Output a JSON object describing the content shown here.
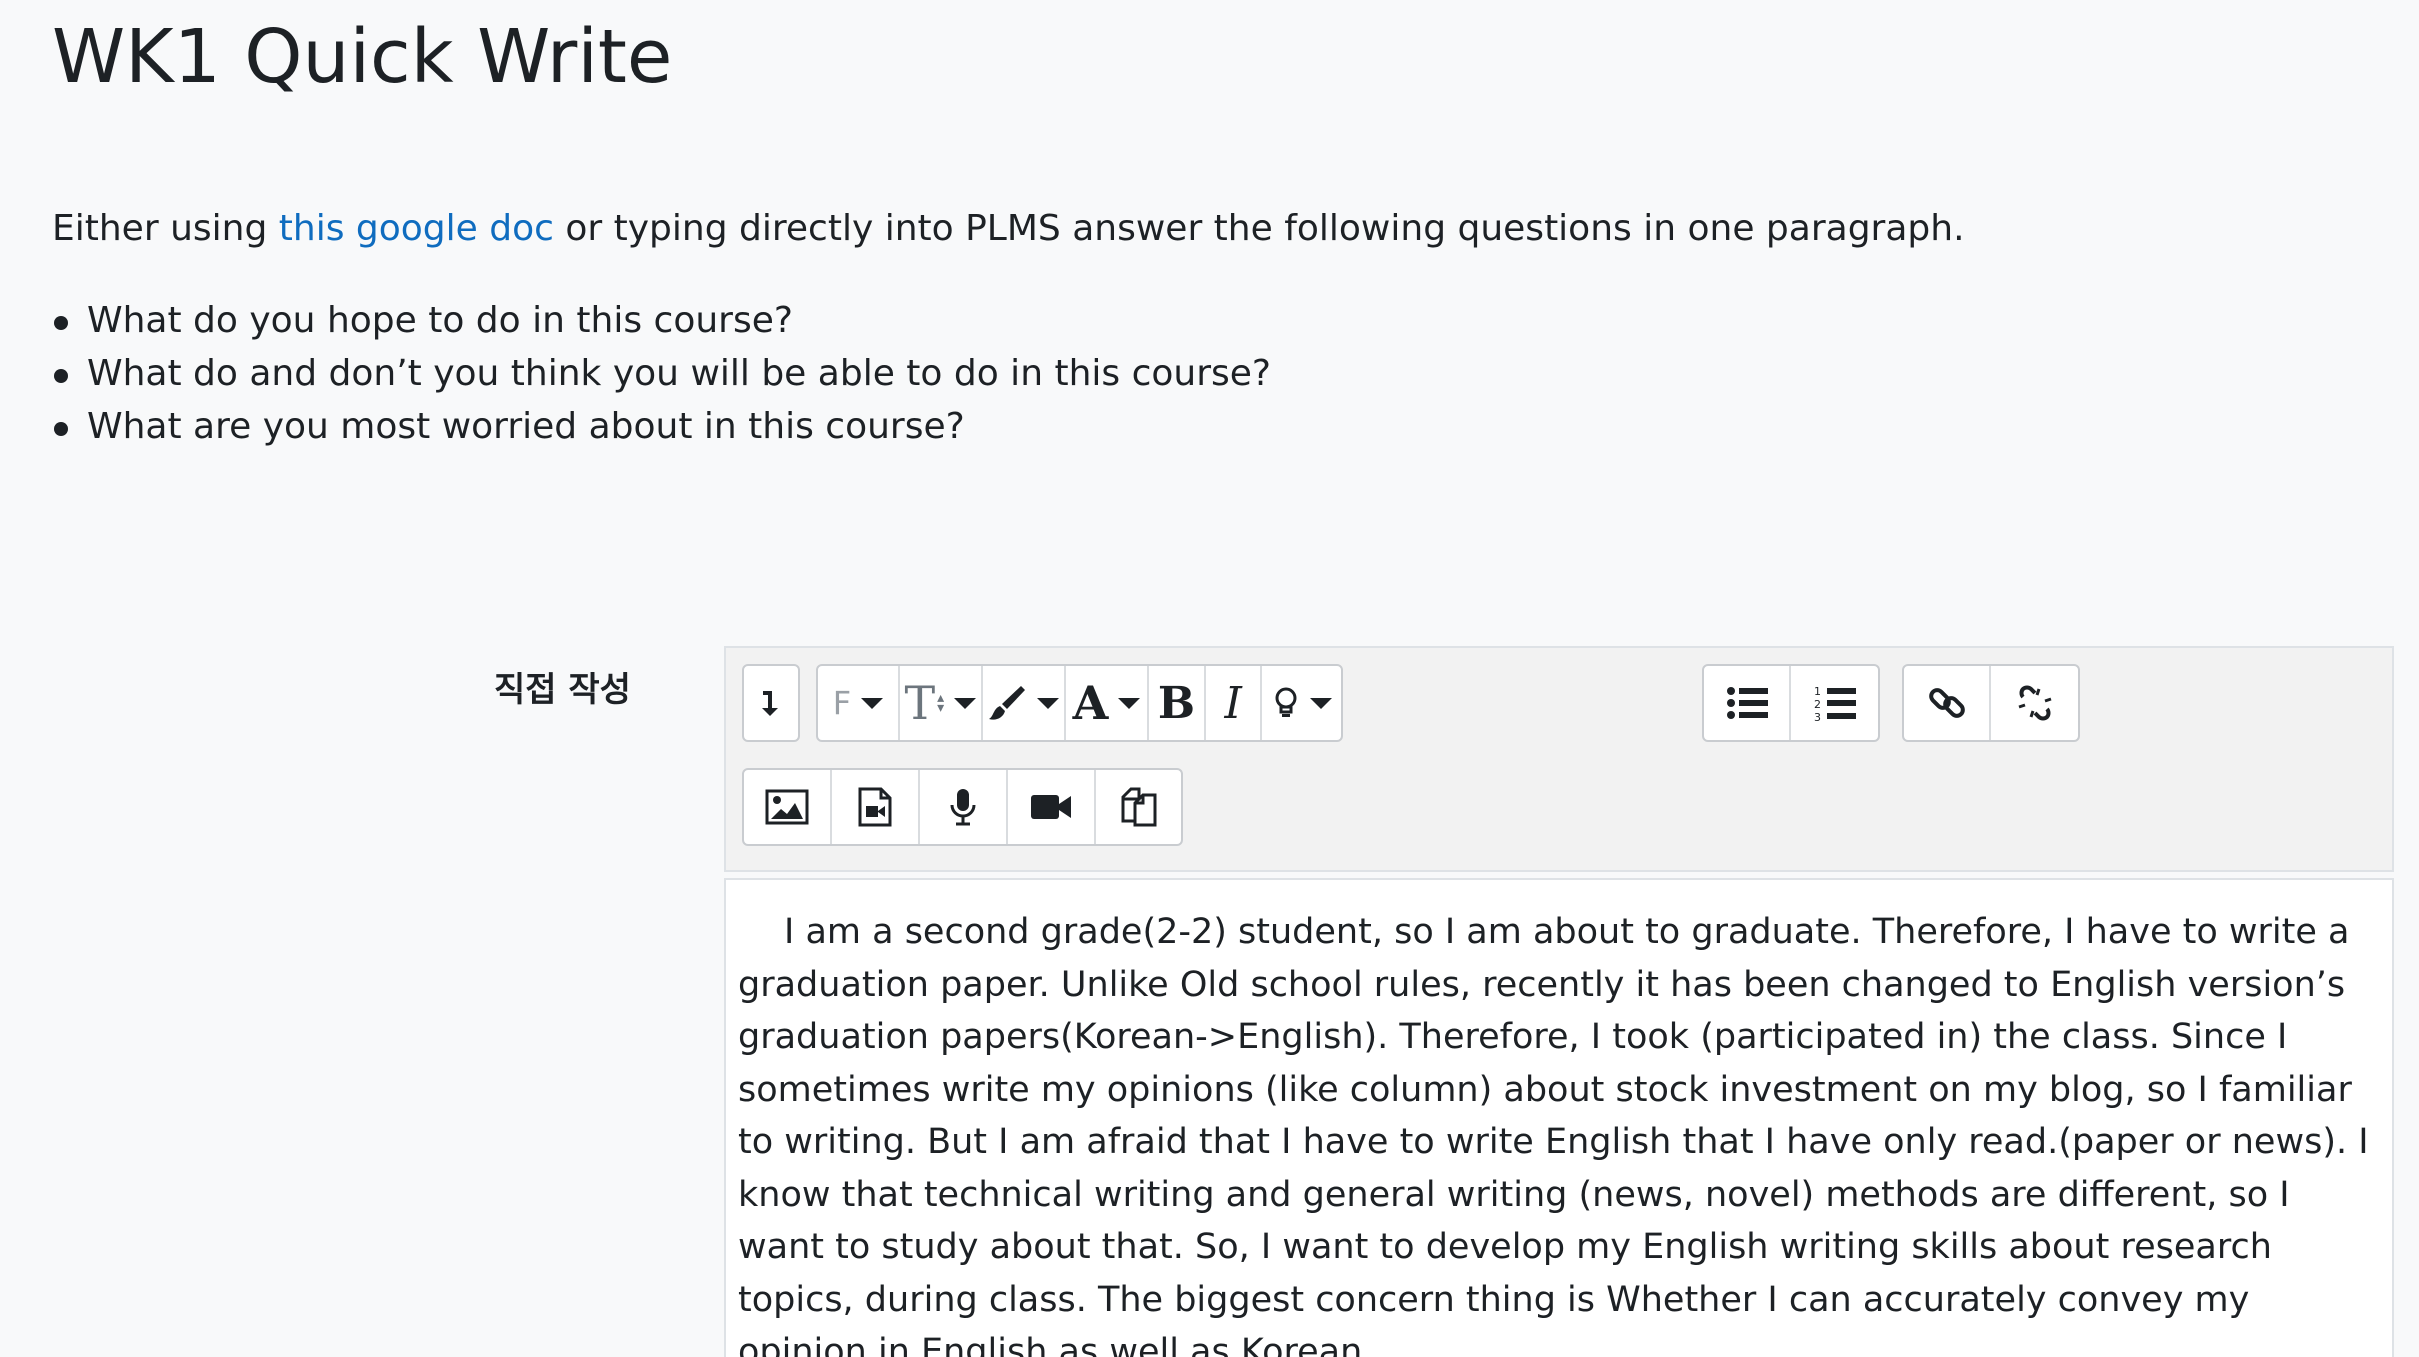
{
  "page": {
    "title": "WK1 Quick Write",
    "intro_prefix": "Either using ",
    "intro_link": "this google doc",
    "intro_suffix": " or typing directly into PLMS answer the following questions in one paragraph.",
    "questions": [
      "What do you hope to do in this course?",
      "What do and don’t you think you will be able to do in this course?",
      "What are you most worried about in this course?"
    ]
  },
  "form": {
    "field_label": "직접 작성"
  },
  "toolbar": {
    "font_family_glyph": "F",
    "font_size_glyph": "T",
    "font_color_glyph": "A",
    "bold_glyph": "B",
    "italic_glyph": "I",
    "icons": [
      "toggle-toolbar-icon",
      "font-family-icon",
      "font-size-icon",
      "highlight-brush-icon",
      "font-color-icon",
      "bold-icon",
      "italic-icon",
      "lightbulb-icon",
      "unordered-list-icon",
      "ordered-list-icon",
      "link-icon",
      "unlink-icon",
      "image-icon",
      "media-icon",
      "microphone-icon",
      "video-camera-icon",
      "copy-paste-icon"
    ]
  },
  "editor": {
    "content": "I am a second grade(2-2) student, so I am about to graduate. Therefore, I have to write a graduation paper. Unlike Old school rules, recently it has been changed to English version’s graduation papers(Korean->English). Therefore, I took (participated in) the class. Since I sometimes write my opinions (like column) about stock investment on my blog, so I familiar to writing. But I am afraid that I have to write English that I have only read.(paper or news). I know that technical writing and general writing (news, novel) methods are different, so I want to study about that. So, I want to develop my English writing skills about research topics, during class. The biggest concern thing is Whether I can accurately convey my opinion in English as well as Korean."
  },
  "colors": {
    "link": "#0f6cbf",
    "text": "#1d2125",
    "background": "#f8f9fa",
    "toolbar_bg": "#f2f2f2"
  }
}
